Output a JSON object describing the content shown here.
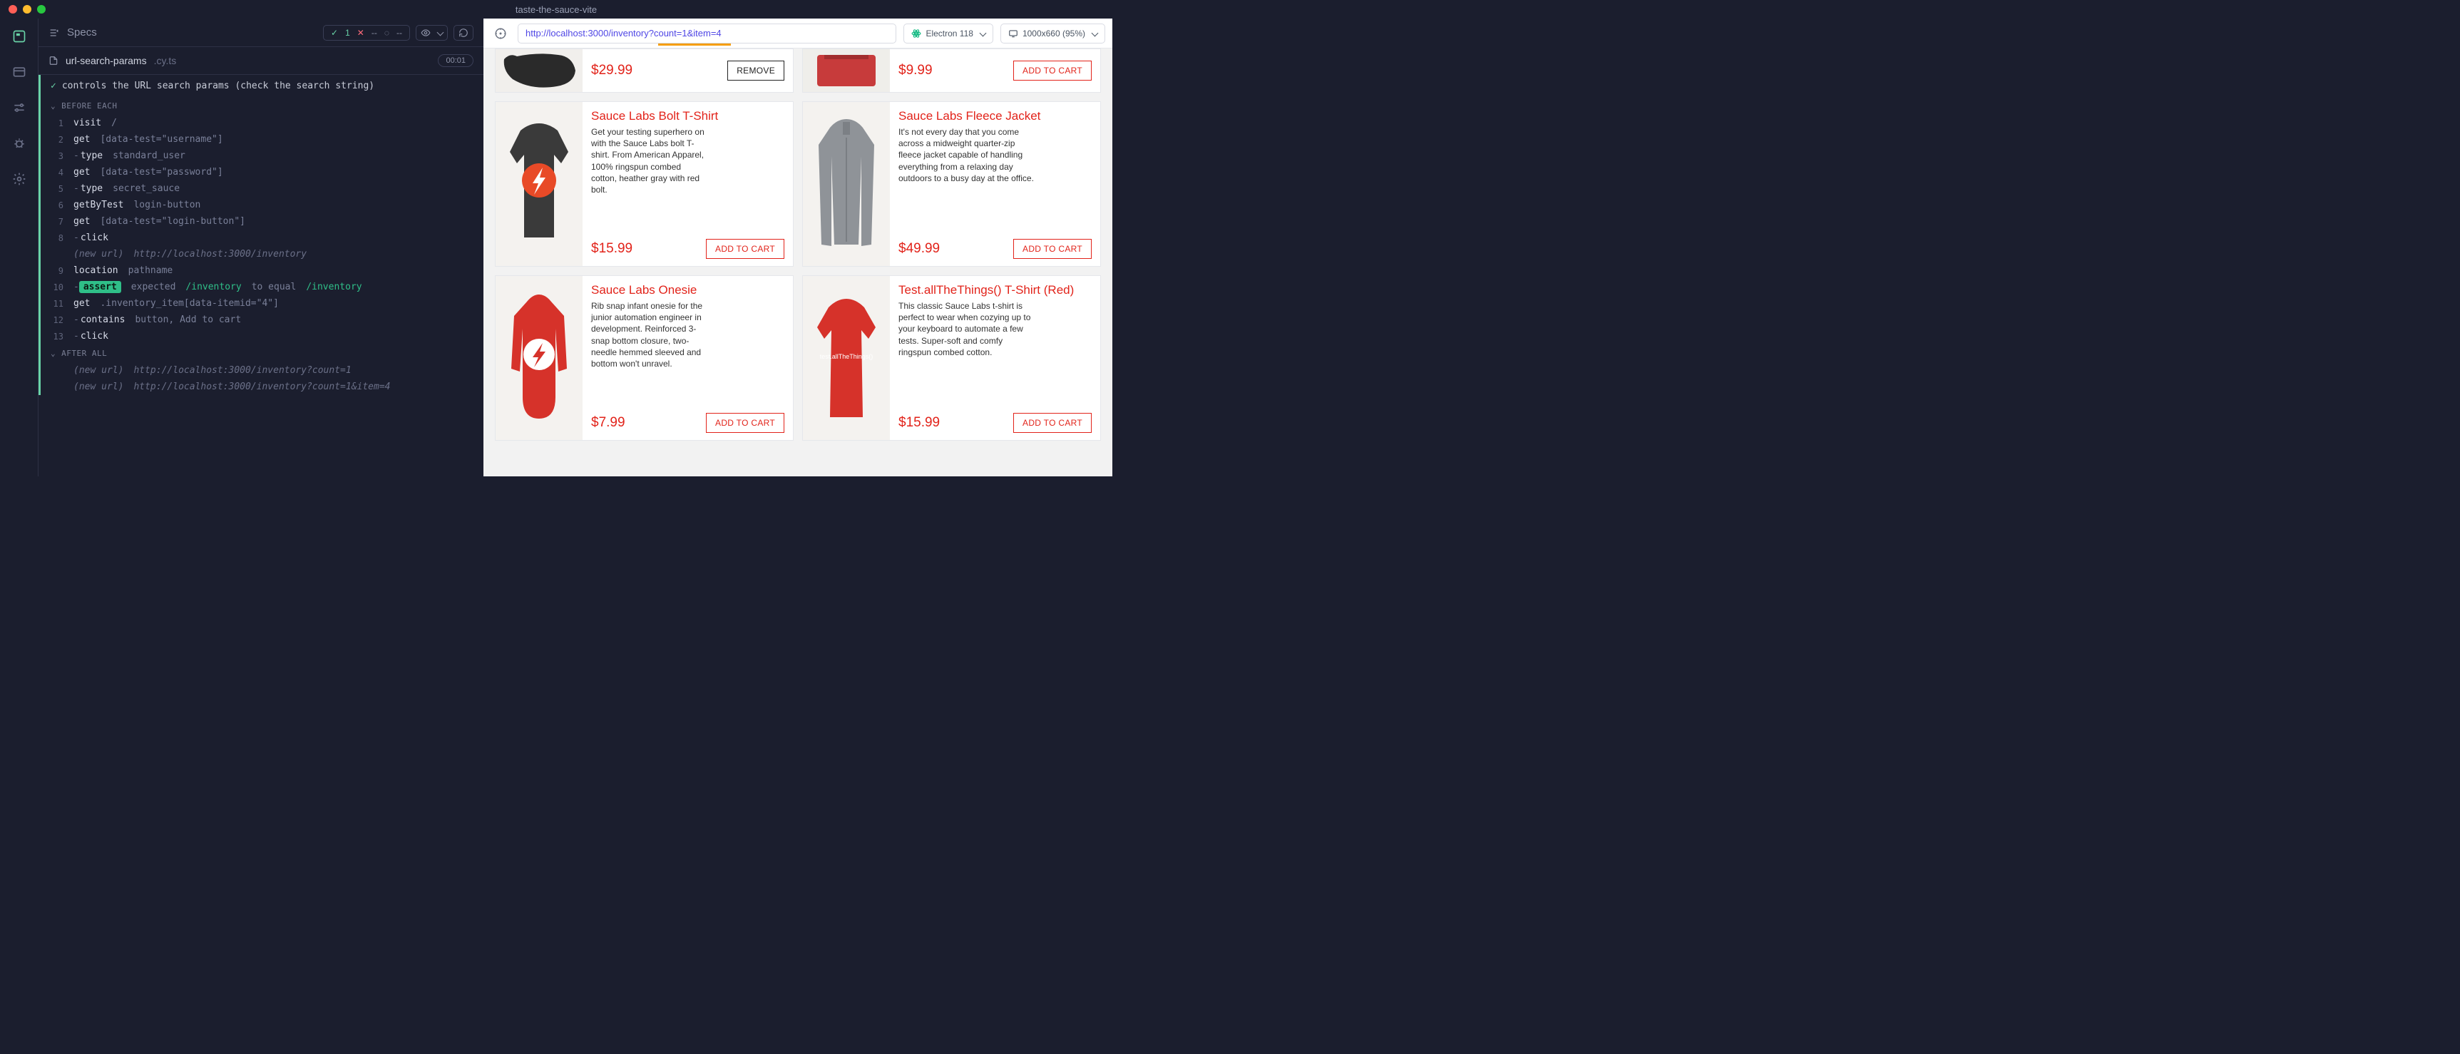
{
  "window": {
    "title": "taste-the-sauce-vite"
  },
  "iconbar": {
    "items": [
      "specs",
      "runs",
      "debug",
      "bug",
      "settings"
    ]
  },
  "header": {
    "specs_label": "Specs",
    "pass_count": "1",
    "fail_mark": "✕",
    "fail_dash": "--",
    "pending": "--"
  },
  "spec": {
    "name": "url-search-params",
    "ext": ".cy.ts",
    "time": "00:01"
  },
  "test": {
    "title": "controls the URL search params (check the search string)"
  },
  "before": {
    "label": "BEFORE EACH"
  },
  "after": {
    "label": "AFTER ALL"
  },
  "commands": [
    {
      "n": "1",
      "name": "visit",
      "arg": "/"
    },
    {
      "n": "2",
      "name": "get",
      "arg": "[data-test=\"username\"]"
    },
    {
      "n": "3",
      "child": true,
      "name": "type",
      "arg": "standard_user"
    },
    {
      "n": "4",
      "name": "get",
      "arg": "[data-test=\"password\"]"
    },
    {
      "n": "5",
      "child": true,
      "name": "type",
      "arg": "secret_sauce"
    },
    {
      "n": "6",
      "name": "getByTest",
      "arg": "login-button"
    },
    {
      "n": "7",
      "name": "get",
      "arg": "[data-test=\"login-button\"]"
    },
    {
      "n": "8",
      "child": true,
      "name": "click",
      "arg": ""
    },
    {
      "event": "(new url)",
      "url": "http://localhost:3000/inventory"
    },
    {
      "n": "9",
      "name": "location",
      "arg": "pathname"
    },
    {
      "n": "10",
      "assert": true,
      "expected": "expected",
      "lhs": "/inventory",
      "op": "to equal",
      "rhs": "/inventory"
    },
    {
      "n": "11",
      "name": "get",
      "arg": ".inventory_item[data-itemid=\"4\"]"
    },
    {
      "n": "12",
      "child": true,
      "name": "contains",
      "arg": "button, Add to cart"
    },
    {
      "n": "13",
      "child": true,
      "name": "click",
      "arg": ""
    }
  ],
  "after_events": [
    {
      "event": "(new url)",
      "url": "http://localhost:3000/inventory?count=1"
    },
    {
      "event": "(new url)",
      "url": "http://localhost:3000/inventory?count=1&item=4"
    }
  ],
  "preview": {
    "url_prefix": "http://localhost:3000/inventory",
    "url_query": "?count=1&item=4",
    "browser": "Electron 118",
    "viewport": "1000x660 (95%)"
  },
  "prices_top": {
    "left": "$29.99",
    "right": "$9.99"
  },
  "btns": {
    "remove": "REMOVE",
    "add": "ADD TO CART"
  },
  "products": {
    "bolt": {
      "title": "Sauce Labs Bolt T-Shirt",
      "desc": "Get your testing superhero on with the Sauce Labs bolt T-shirt. From American Apparel, 100% ringspun combed cotton, heather gray with red bolt.",
      "price": "$15.99"
    },
    "fleece": {
      "title": "Sauce Labs Fleece Jacket",
      "desc": "It's not every day that you come across a midweight quarter-zip fleece jacket capable of handling everything from a relaxing day outdoors to a busy day at the office.",
      "price": "$49.99"
    },
    "onesie": {
      "title": "Sauce Labs Onesie",
      "desc": "Rib snap infant onesie for the junior automation engineer in development. Reinforced 3-snap bottom closure, two-needle hemmed sleeved and bottom won't unravel.",
      "price": "$7.99"
    },
    "redshirt": {
      "title": "Test.allTheThings() T-Shirt (Red)",
      "desc": "This classic Sauce Labs t-shirt is perfect to wear when cozying up to your keyboard to automate a few tests. Super-soft and comfy ringspun combed cotton.",
      "price": "$15.99"
    }
  }
}
